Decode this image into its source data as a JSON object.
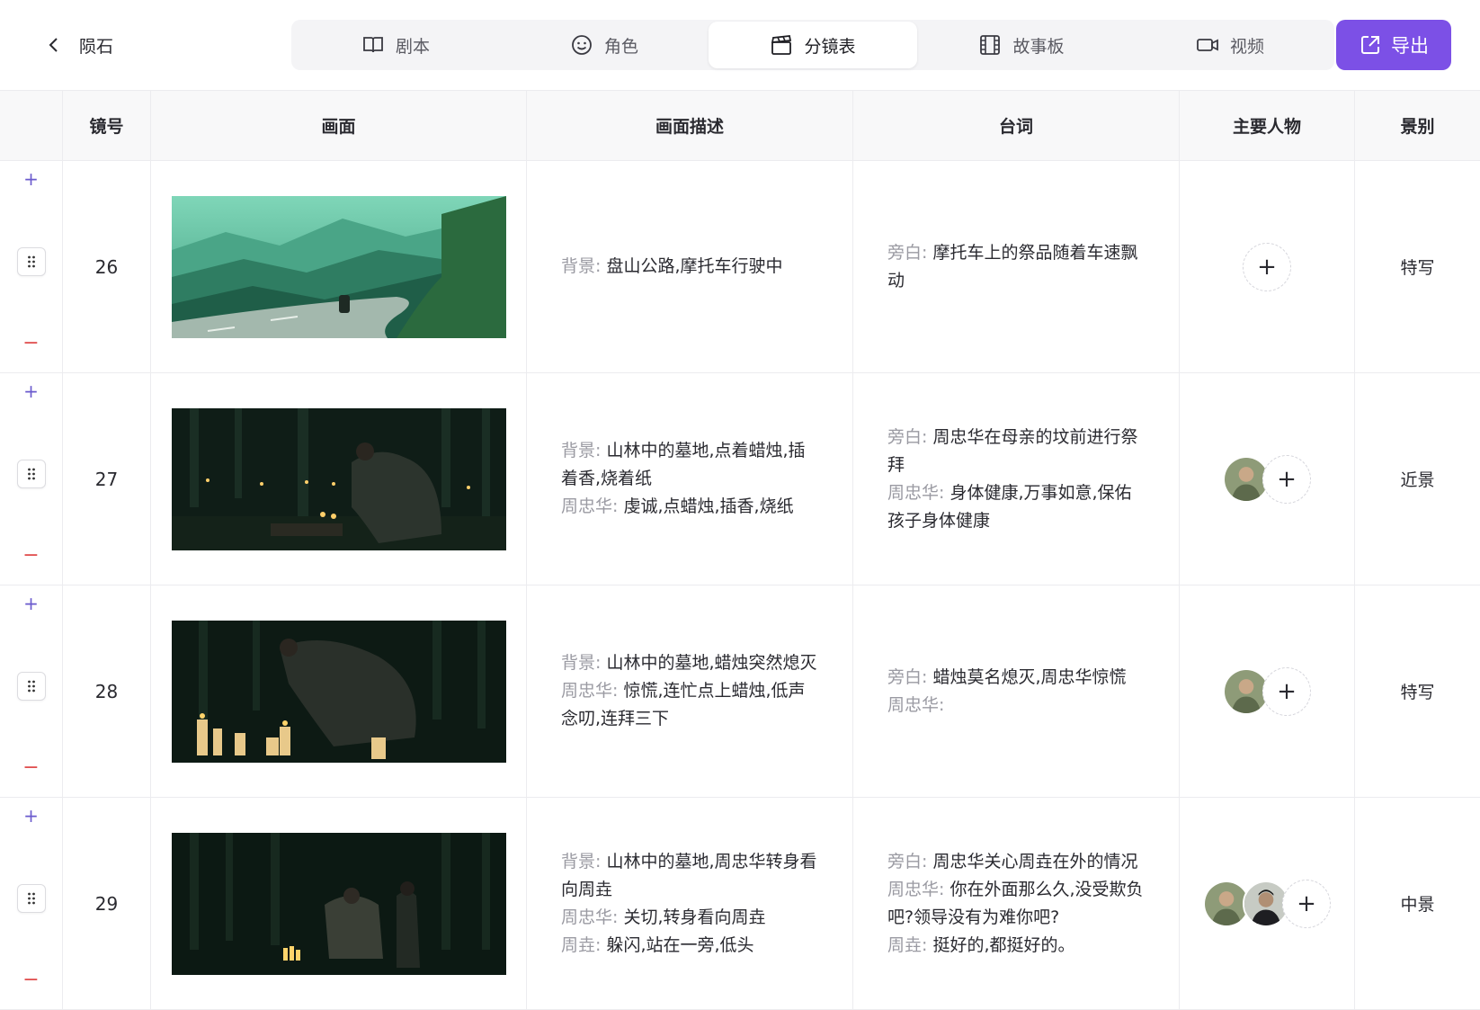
{
  "header": {
    "back_title": "陨石"
  },
  "tabs": [
    {
      "label": "剧本",
      "icon": "book-icon"
    },
    {
      "label": "角色",
      "icon": "smiley-icon"
    },
    {
      "label": "分镜表",
      "icon": "clapperboard-icon",
      "active": true
    },
    {
      "label": "故事板",
      "icon": "film-icon"
    },
    {
      "label": "视频",
      "icon": "video-camera-icon"
    }
  ],
  "export_label": "导出",
  "table": {
    "columns": [
      "",
      "镜号",
      "画面",
      "画面描述",
      "台词",
      "主要人物",
      "景别"
    ],
    "rows": [
      {
        "no": "26",
        "image": "mountain-road-motorcycle",
        "desc": [
          {
            "label": "背景:",
            "text": "盘山公路,摩托车行驶中"
          }
        ],
        "lines": [
          {
            "label": "旁白:",
            "text": "摩托车上的祭品随着车速飘动"
          }
        ],
        "characters": [],
        "shot": "特写"
      },
      {
        "no": "27",
        "image": "forest-grave-candles",
        "desc": [
          {
            "label": "背景:",
            "text": "山林中的墓地,点着蜡烛,插着香,烧着纸"
          },
          {
            "label": "周忠华:",
            "text": "虔诚,点蜡烛,插香,烧纸"
          }
        ],
        "lines": [
          {
            "label": "旁白:",
            "text": "周忠华在母亲的坟前进行祭拜"
          },
          {
            "label": "周忠华:",
            "text": "身体健康,万事如意,保佑孩子身体健康"
          }
        ],
        "characters": [
          "zhou-zhonghua"
        ],
        "shot": "近景"
      },
      {
        "no": "28",
        "image": "forest-candles-extinguished",
        "desc": [
          {
            "label": "背景:",
            "text": "山林中的墓地,蜡烛突然熄灭"
          },
          {
            "label": "周忠华:",
            "text": "惊慌,连忙点上蜡烛,低声念叨,连拜三下"
          }
        ],
        "lines": [
          {
            "label": "旁白:",
            "text": "蜡烛莫名熄灭,周忠华惊慌"
          },
          {
            "label": "周忠华:",
            "text": ""
          }
        ],
        "characters": [
          "zhou-zhonghua"
        ],
        "shot": "特写"
      },
      {
        "no": "29",
        "image": "forest-two-figures",
        "desc": [
          {
            "label": "背景:",
            "text": "山林中的墓地,周忠华转身看向周垚"
          },
          {
            "label": "周忠华:",
            "text": "关切,转身看向周垚"
          },
          {
            "label": "周垚:",
            "text": "躲闪,站在一旁,低头"
          }
        ],
        "lines": [
          {
            "label": "旁白:",
            "text": "周忠华关心周垚在外的情况"
          },
          {
            "label": "周忠华:",
            "text": "你在外面那么久,没受欺负吧?领导没有为难你吧?"
          },
          {
            "label": "周垚:",
            "text": "挺好的,都挺好的。"
          }
        ],
        "characters": [
          "zhou-zhonghua",
          "zhou-yao"
        ],
        "shot": "中景"
      }
    ]
  },
  "colors": {
    "accent": "#7c50e6",
    "add": "#6a5acd",
    "remove": "#e05050"
  }
}
